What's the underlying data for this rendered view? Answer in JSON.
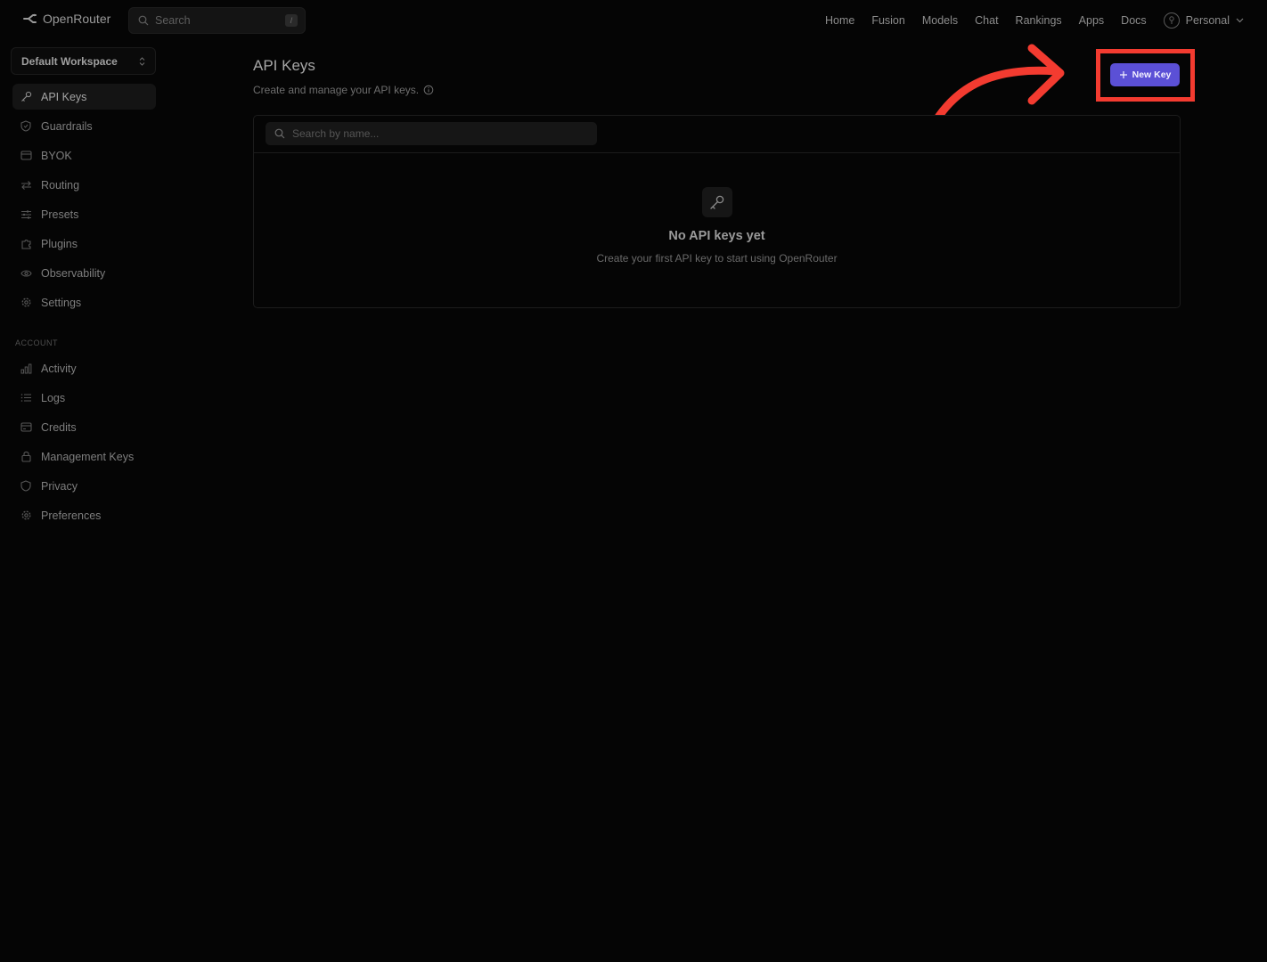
{
  "header": {
    "brand": "OpenRouter",
    "search_placeholder": "Search",
    "search_shortcut": "/",
    "nav": [
      "Home",
      "Fusion",
      "Models",
      "Chat",
      "Rankings",
      "Apps",
      "Docs"
    ],
    "account_label": "Personal"
  },
  "sidebar": {
    "workspace": "Default Workspace",
    "items": [
      {
        "label": "API Keys",
        "icon": "key-icon",
        "active": true
      },
      {
        "label": "Guardrails",
        "icon": "shield-icon"
      },
      {
        "label": "BYOK",
        "icon": "card-icon"
      },
      {
        "label": "Routing",
        "icon": "arrows-icon"
      },
      {
        "label": "Presets",
        "icon": "sliders-icon"
      },
      {
        "label": "Plugins",
        "icon": "puzzle-icon"
      },
      {
        "label": "Observability",
        "icon": "eye-icon"
      },
      {
        "label": "Settings",
        "icon": "gear-icon"
      }
    ],
    "account_section_label": "ACCOUNT",
    "account_items": [
      {
        "label": "Activity",
        "icon": "bar-chart-icon"
      },
      {
        "label": "Logs",
        "icon": "list-icon"
      },
      {
        "label": "Credits",
        "icon": "credit-card-icon"
      },
      {
        "label": "Management Keys",
        "icon": "lock-icon"
      },
      {
        "label": "Privacy",
        "icon": "shield-icon"
      },
      {
        "label": "Preferences",
        "icon": "gear-icon"
      }
    ]
  },
  "main": {
    "title": "API Keys",
    "subtitle": "Create and manage your API keys.",
    "new_key_label": "New Key",
    "search_placeholder": "Search by name...",
    "empty_title": "No API keys yet",
    "empty_desc": "Create your first API key to start using OpenRouter"
  },
  "annotation": {
    "color": "#f33b30"
  },
  "colors": {
    "accent": "#5b50d6",
    "background": "#050505"
  }
}
